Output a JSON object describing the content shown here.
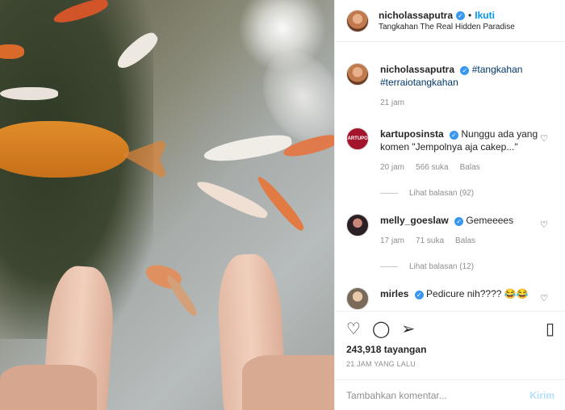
{
  "post": {
    "username": "nicholassaputra",
    "follow_label": "Ikuti",
    "location": "Tangkahan The Real Hidden Paradise"
  },
  "caption": {
    "username": "nicholassaputra",
    "hashtag1": "#tangkahan",
    "hashtag2": "#terraiotangkahan",
    "time": "21 jam"
  },
  "comments": [
    {
      "username": "kartuposinsta",
      "avatar_text": "KARTUPOS",
      "text": "Nunggu ada yang komen \"Jempolnya aja cakep...\"",
      "time": "20 jam",
      "likes": "566 suka",
      "reply_label": "Balas",
      "view_replies": "Lihat balasan (92)"
    },
    {
      "username": "melly_goeslaw",
      "text": "Gemeeees",
      "time": "17 jam",
      "likes": "71 suka",
      "reply_label": "Balas",
      "view_replies": "Lihat balasan (12)"
    },
    {
      "username": "mirles",
      "text": "Pedicure nih???? 😂😂"
    }
  ],
  "stats": {
    "views": "243,918 tayangan",
    "timestamp": "21 JAM YANG LALU"
  },
  "add_comment": {
    "placeholder": "Tambahkan komentar...",
    "post_label": "Kirim"
  },
  "colors": {
    "accent": "#0095f6",
    "verified": "#3897f0",
    "muted": "#8e8e8e"
  },
  "icons": {
    "verified": "verified-badge-icon",
    "like": "heart-icon",
    "comment": "comment-icon",
    "share": "share-icon",
    "save": "bookmark-icon"
  }
}
